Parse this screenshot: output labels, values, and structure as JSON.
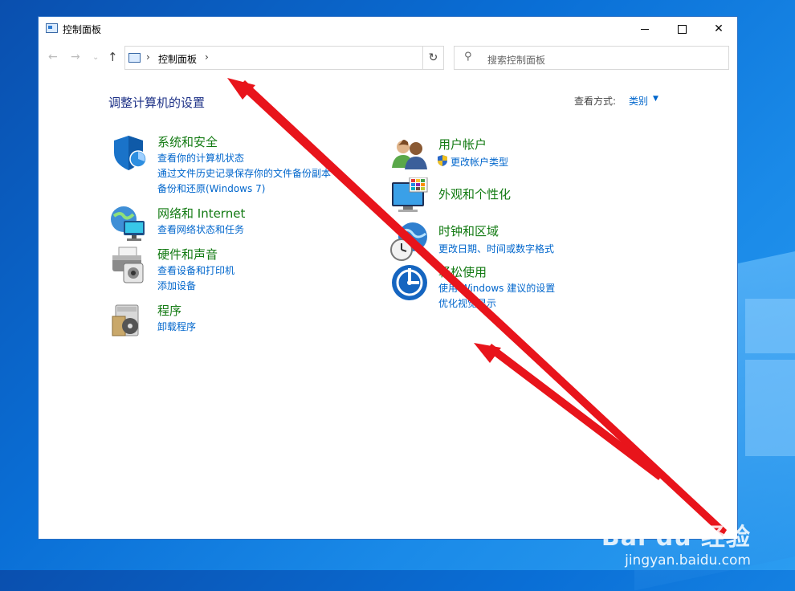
{
  "window": {
    "title": "控制面板"
  },
  "nav": {
    "back_glyph": "←",
    "forward_glyph": "→",
    "recent_glyph": "⌄",
    "up_glyph": "↑",
    "address_sep": "›",
    "address_path": "控制面板",
    "dropdown_glyph": "⌄",
    "refresh_glyph": "↻"
  },
  "search": {
    "placeholder": "搜索控制面板",
    "icon_glyph": "⚲"
  },
  "heading": "调整计算机的设置",
  "view_by": {
    "label": "查看方式:",
    "value": "类别",
    "arrow": "▼"
  },
  "categories_left": [
    {
      "icon": "shield-icon",
      "title": "系统和安全",
      "links": [
        "查看你的计算机状态",
        "通过文件历史记录保存你的文件备份副本",
        "备份和还原(Windows 7)"
      ]
    },
    {
      "icon": "network-globe-icon",
      "title": "网络和 Internet",
      "links": [
        "查看网络状态和任务"
      ]
    },
    {
      "icon": "printer-icon",
      "title": "硬件和声音",
      "links": [
        "查看设备和打印机",
        "添加设备"
      ]
    },
    {
      "icon": "programs-icon",
      "title": "程序",
      "links": [
        "卸载程序"
      ]
    }
  ],
  "categories_right": [
    {
      "icon": "users-icon",
      "title": "用户帐户",
      "links": [
        "更改帐户类型"
      ]
    },
    {
      "icon": "display-palette-icon",
      "title": "外观和个性化",
      "links": []
    },
    {
      "icon": "clock-globe-icon",
      "title": "时钟和区域",
      "links": [
        "更改日期、时间或数字格式"
      ]
    },
    {
      "icon": "ease-of-access-icon",
      "title": "轻松使用",
      "links": [
        "使用 Windows 建议的设置",
        "优化视觉显示"
      ]
    }
  ],
  "watermark": {
    "brand": "Bai du 经验",
    "url": "jingyan.baidu.com"
  },
  "colors": {
    "link": "#0066cc",
    "category_title": "#127a12",
    "heading": "#1e3287",
    "annotation_arrow": "#e8141b"
  }
}
